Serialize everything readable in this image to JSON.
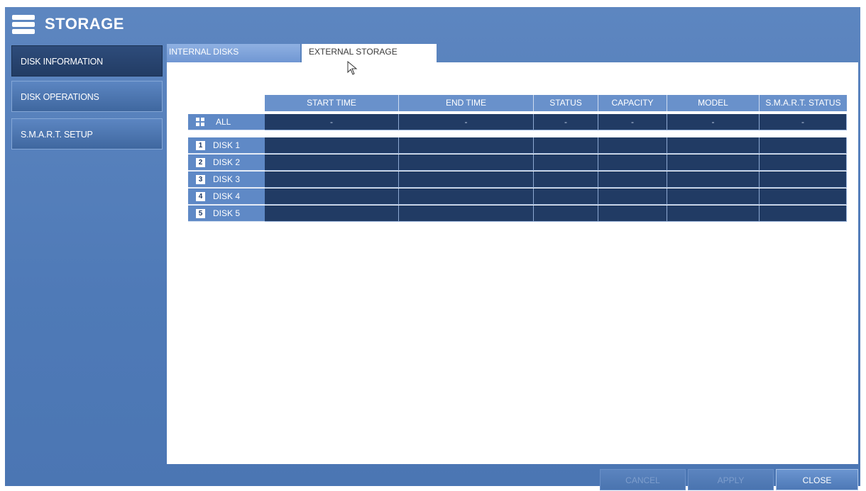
{
  "header": {
    "title": "STORAGE",
    "icon": "storage-menu-icon"
  },
  "sidebar": {
    "items": [
      {
        "label": "DISK INFORMATION",
        "active": true
      },
      {
        "label": "DISK OPERATIONS",
        "active": false
      },
      {
        "label": "S.M.A.R.T. SETUP",
        "active": false
      }
    ]
  },
  "tabs": [
    {
      "label": "INTERNAL DISKS",
      "active": false
    },
    {
      "label": "EXTERNAL STORAGE",
      "active": true
    }
  ],
  "table": {
    "columns": [
      "START TIME",
      "END TIME",
      "STATUS",
      "CAPACITY",
      "MODEL",
      "S.M.A.R.T. STATUS"
    ],
    "all_row": {
      "label": "ALL",
      "values": [
        "-",
        "-",
        "-",
        "-",
        "-",
        "-"
      ]
    },
    "disks": [
      {
        "num": "1",
        "label": "DISK 1"
      },
      {
        "num": "2",
        "label": "DISK 2"
      },
      {
        "num": "3",
        "label": "DISK 3"
      },
      {
        "num": "4",
        "label": "DISK 4"
      },
      {
        "num": "5",
        "label": "DISK 5"
      }
    ]
  },
  "buttons": {
    "cancel": "CANCEL",
    "apply": "APPLY",
    "close": "CLOSE"
  },
  "colors": {
    "background": "#4f7ab7",
    "cell": "#213b64",
    "header_cell": "#6991cb"
  }
}
